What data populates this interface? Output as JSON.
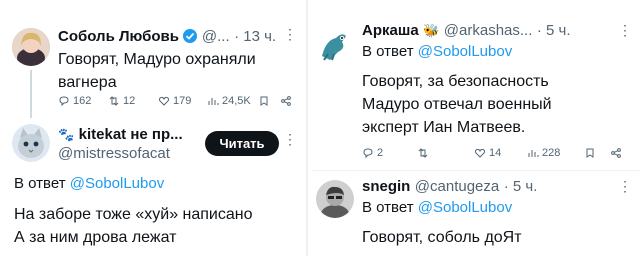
{
  "left": {
    "tweet1": {
      "author_name": "Соболь Любовь",
      "handle": "@...",
      "time": "· 13 ч.",
      "text_line1": "Говорят, Мадуро охраняли",
      "text_line2": "вагнера",
      "stats": {
        "replies": "162",
        "retweets": "12",
        "likes": "179",
        "views": "24,5K"
      }
    },
    "tweet2": {
      "author_name": "kitekat не пр...",
      "handle": "@mistressofacat",
      "follow_button": "Читать",
      "reply_prefix": "В ответ",
      "reply_to": "@SobolLubov",
      "text_line1": "На заборе тоже «хуй» написано",
      "text_line2": "А за ним дрова лежат"
    }
  },
  "right": {
    "tweet1": {
      "author_name": "Аркаша",
      "handle": "@arkashas...",
      "time": "· 5 ч.",
      "reply_prefix": "В ответ",
      "reply_to": "@SobolLubov",
      "text_line1": "Говорят, за безопасность",
      "text_line2": "Мадуро отвечал военный",
      "text_line3": "эксперт Иан Матвеев.",
      "stats": {
        "replies": "2",
        "likes": "14",
        "views": "228"
      }
    },
    "tweet2": {
      "author_name": "snegin",
      "handle": "@cantugeza",
      "time": "· 5 ч.",
      "reply_prefix": "В ответ",
      "reply_to": "@SobolLubov",
      "text_line1": "Говорят, соболь доЯт"
    }
  }
}
